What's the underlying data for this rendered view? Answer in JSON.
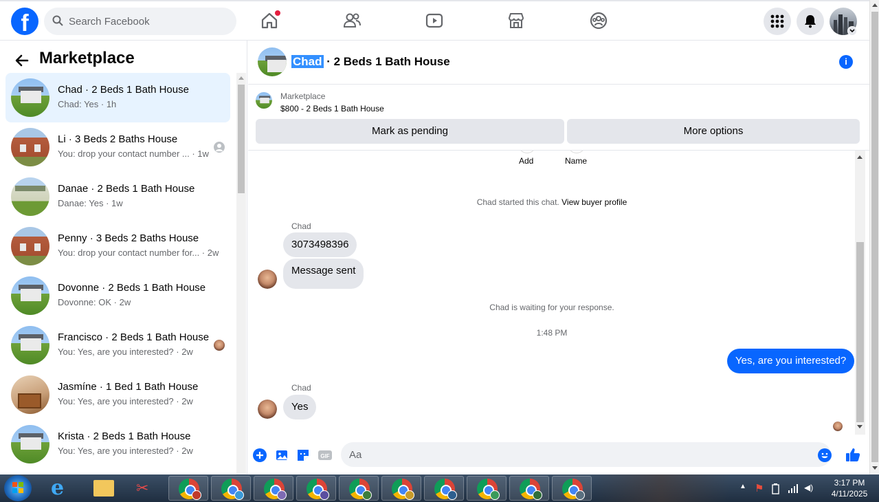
{
  "topnav": {
    "logo": "f",
    "search_placeholder": "Search Facebook",
    "icons": [
      "home-icon",
      "friends-icon",
      "video-icon",
      "marketplace-icon",
      "groups-icon",
      "menu-grid-icon",
      "bell-icon",
      "profile-avatar"
    ]
  },
  "sidebar": {
    "title": "Marketplace",
    "conversations": [
      {
        "title": "Chad · 2 Beds 1 Bath House",
        "subtitle": "Chad: Yes · 1h",
        "active": true
      },
      {
        "title": "Li · 3 Beds 2 Baths House",
        "subtitle": "You: drop your contact number ... · 1w"
      },
      {
        "title": "Danae · 2 Beds 1 Bath House",
        "subtitle": "Danae: Yes · 1w"
      },
      {
        "title": "Penny · 3 Beds 2 Baths House",
        "subtitle": "You: drop your contact number for... · 2w"
      },
      {
        "title": "Dovonne · 2 Beds 1 Bath House",
        "subtitle": "Dovonne: OK · 2w"
      },
      {
        "title": "Francisco · 2 Beds 1 Bath House",
        "subtitle": "You: Yes, are you interested? · 2w"
      },
      {
        "title": "Jasmíne · 1 Bed 1 Bath House",
        "subtitle": "You: Yes, are you interested? · 2w"
      },
      {
        "title": "Krista · 2 Beds 1 Bath House",
        "subtitle": "You: Yes, are you interested? · 2w"
      }
    ]
  },
  "chat": {
    "header_name": "Chad",
    "header_rest": " · 2 Beds 1 Bath House",
    "info_icon": "i",
    "listing": {
      "source": "Marketplace",
      "price_title": "$800 - 2 Beds 1 Bath House",
      "btn_pending": "Mark as pending",
      "btn_more": "More options"
    },
    "cut_labels": {
      "add": "Add",
      "name": "Name"
    },
    "started_text": "Chad started this chat. ",
    "buyer_profile_link": "View buyer profile",
    "sender_name": "Chad",
    "msg_phone": "3073498396",
    "msg_sent": "Message sent",
    "waiting_text": "Chad is waiting for your response.",
    "timestamp": "1:48 PM",
    "msg_out": "Yes, are you interested?",
    "sender_name_2": "Chad",
    "msg_yes": "Yes",
    "composer_placeholder": "Aa"
  },
  "taskbar": {
    "time": "3:17 PM",
    "date": "4/11/2025",
    "ie_glyph": "e",
    "snip_glyph": "✂",
    "flag_glyph": "⚑",
    "signal_glyph": "▮",
    "volume_glyph": "◀)",
    "chevron_glyph": "▲"
  },
  "colors": {
    "brand": "#0866ff",
    "active_row": "#e7f3ff",
    "bubble_in": "#e4e6eb",
    "bubble_out": "#0866ff"
  }
}
